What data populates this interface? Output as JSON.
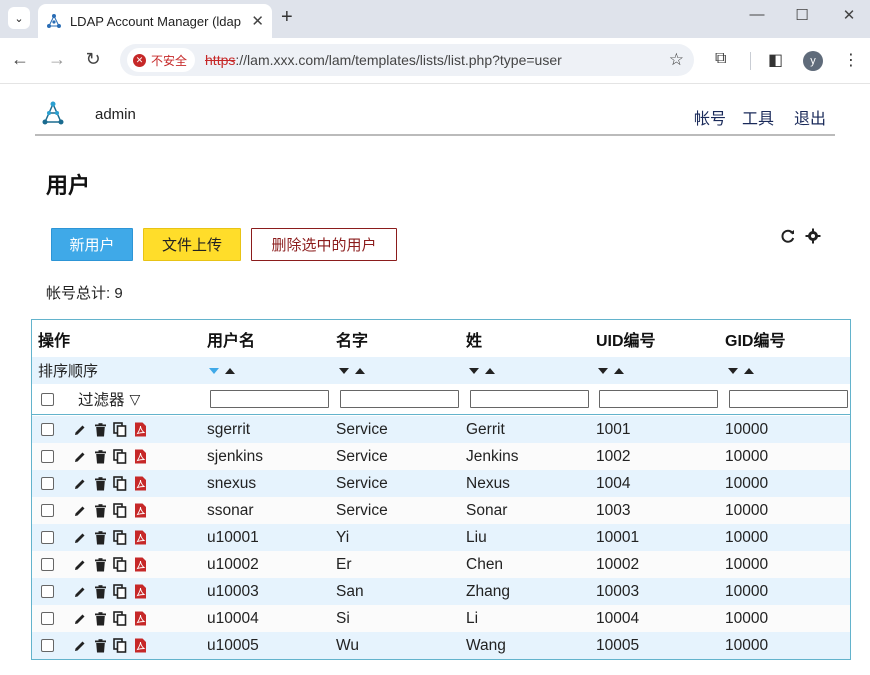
{
  "browser": {
    "tab_title": "LDAP Account Manager (ldap",
    "security_label": "不安全",
    "url_scheme": "https",
    "url_rest": "://lam.xxx.com/lam/templates/lists/list.php?type=user",
    "profile_initial": "y"
  },
  "header": {
    "user": "admin",
    "links": [
      "帐号",
      "工具",
      "退出"
    ]
  },
  "page": {
    "title": "用户",
    "buttons": {
      "new": "新用户",
      "upload": "文件上传",
      "delete": "删除选中的用户"
    },
    "total_label": "帐号总计: 9"
  },
  "table": {
    "headers": [
      "操作",
      "用户名",
      "名字",
      "姓",
      "UID编号",
      "GID编号"
    ],
    "sort_label": "排序顺序",
    "filter_label": "过滤器",
    "rows": [
      {
        "username": "sgerrit",
        "first": "Service",
        "last": "Gerrit",
        "uid": "1001",
        "gid": "10000"
      },
      {
        "username": "sjenkins",
        "first": "Service",
        "last": "Jenkins",
        "uid": "1002",
        "gid": "10000"
      },
      {
        "username": "snexus",
        "first": "Service",
        "last": "Nexus",
        "uid": "1004",
        "gid": "10000"
      },
      {
        "username": "ssonar",
        "first": "Service",
        "last": "Sonar",
        "uid": "1003",
        "gid": "10000"
      },
      {
        "username": "u10001",
        "first": "Yi",
        "last": "Liu",
        "uid": "10001",
        "gid": "10000"
      },
      {
        "username": "u10002",
        "first": "Er",
        "last": "Chen",
        "uid": "10002",
        "gid": "10000"
      },
      {
        "username": "u10003",
        "first": "San",
        "last": "Zhang",
        "uid": "10003",
        "gid": "10000"
      },
      {
        "username": "u10004",
        "first": "Si",
        "last": "Li",
        "uid": "10004",
        "gid": "10000"
      },
      {
        "username": "u10005",
        "first": "Wu",
        "last": "Wang",
        "uid": "10005",
        "gid": "10000"
      }
    ]
  },
  "colors": {
    "accent": "#3fa9e8",
    "upload": "#ffdd2a",
    "delete": "#8b1c1c",
    "row_alt": "#e6f3fd",
    "table_border": "#63b3cc"
  }
}
